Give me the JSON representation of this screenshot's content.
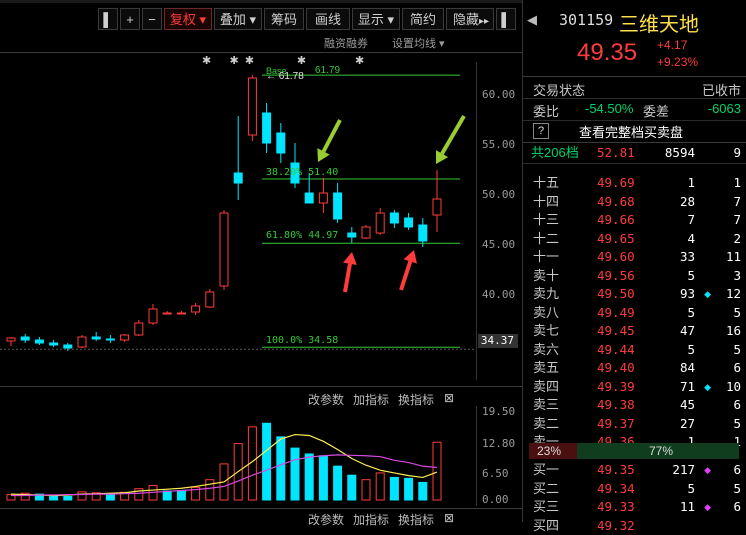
{
  "toolbar": {
    "items": [
      "复权 ▾",
      "叠加 ▾",
      "筹码",
      "画线",
      "显示 ▾",
      "简约",
      "隐藏"
    ],
    "plus": "+",
    "left_glyph": "▌",
    "nav_glyph": "▸▸",
    "sub_links": [
      "融资融券",
      "设置均线 ▾"
    ]
  },
  "chart": {
    "stars": "✱      ✱  ✱              ✱                ✱",
    "y_ticks": [
      "60.00",
      "55.00",
      "50.00",
      "45.00",
      "40.00"
    ],
    "current_price_tag": "34.37",
    "base_label": "Base",
    "hi_label": "← 61.78",
    "hi_label2": "61.79",
    "fib_382": "38.20% 51.40",
    "fib_618": "61.80% 44.97",
    "fib_100": "100.0% 34.58",
    "colors": {
      "up": "#ff3b3b",
      "down": "#00e5ff",
      "fib": "#35c935",
      "arrow_green": "#9acd32",
      "arrow_red": "#ff3b3b",
      "ma_yellow": "#ffee55",
      "ma_purple": "#d64ae0"
    }
  },
  "volume": {
    "links": [
      "改参数",
      "加指标",
      "换指标"
    ],
    "close": "⊠",
    "y_ticks": [
      "19.50",
      "12.80",
      "6.50",
      "0.00"
    ]
  },
  "chart_data": {
    "type": "candlestick",
    "ylim": [
      32,
      63
    ],
    "candles": [
      [
        35.2,
        35.6,
        34.7,
        35.5
      ],
      [
        35.6,
        35.9,
        35.0,
        35.3
      ],
      [
        35.3,
        35.6,
        34.8,
        35.0
      ],
      [
        35.0,
        35.3,
        34.6,
        34.8
      ],
      [
        34.8,
        35.0,
        34.2,
        34.5
      ],
      [
        34.6,
        35.8,
        34.5,
        35.6
      ],
      [
        35.6,
        36.1,
        35.2,
        35.4
      ],
      [
        35.4,
        35.8,
        35.0,
        35.3
      ],
      [
        35.3,
        35.9,
        35.1,
        35.8
      ],
      [
        35.8,
        37.3,
        35.7,
        37.0
      ],
      [
        37.0,
        38.9,
        36.8,
        38.4
      ],
      [
        38.0,
        38.2,
        37.9,
        38.0
      ],
      [
        38.0,
        38.2,
        37.9,
        38.0
      ],
      [
        38.1,
        39.0,
        37.8,
        38.7
      ],
      [
        38.6,
        40.4,
        38.5,
        40.1
      ],
      [
        40.7,
        48.3,
        40.3,
        48.0
      ],
      [
        52.0,
        57.7,
        49.3,
        51.0
      ],
      [
        55.8,
        61.8,
        55.2,
        61.5
      ],
      [
        58.0,
        59.0,
        54.0,
        55.0
      ],
      [
        56.0,
        57.0,
        53.0,
        54.0
      ],
      [
        53.0,
        55.0,
        50.5,
        51.0
      ],
      [
        50.0,
        52.0,
        49.0,
        49.0
      ],
      [
        49.0,
        51.5,
        48.0,
        50.0
      ],
      [
        50.0,
        51.0,
        47.0,
        47.4
      ],
      [
        46.0,
        46.6,
        45.0,
        45.6
      ],
      [
        45.5,
        46.8,
        45.4,
        46.6
      ],
      [
        46.0,
        48.5,
        45.8,
        48.0
      ],
      [
        48.0,
        48.3,
        46.5,
        47.0
      ],
      [
        47.5,
        48.0,
        46.3,
        46.6
      ],
      [
        46.8,
        47.5,
        44.6,
        45.2
      ],
      [
        47.8,
        52.3,
        46.1,
        49.4
      ]
    ],
    "volumes": [
      1.2,
      1.5,
      1.3,
      1.0,
      0.8,
      1.8,
      1.6,
      1.4,
      1.7,
      2.5,
      3.2,
      2.0,
      2.1,
      2.8,
      4.5,
      8.0,
      12.5,
      16.2,
      17.0,
      14.0,
      11.5,
      10.2,
      9.8,
      7.5,
      5.5,
      4.5,
      6.0,
      5.0,
      4.8,
      3.9,
      12.8
    ],
    "volume_up": [
      true,
      true,
      false,
      false,
      false,
      true,
      true,
      false,
      true,
      true,
      true,
      false,
      false,
      true,
      true,
      true,
      true,
      true,
      false,
      false,
      false,
      false,
      false,
      false,
      false,
      true,
      true,
      false,
      false,
      false,
      true
    ],
    "ma5": [
      1.3,
      1.2,
      1.1,
      1.0,
      1.1,
      1.3,
      1.4,
      1.5,
      1.6,
      2.0,
      2.2,
      2.4,
      2.6,
      3.0,
      3.5,
      4.0,
      6.3,
      8.5,
      11.0,
      13.5,
      14.5,
      14.3,
      13.0,
      11.2,
      9.2,
      7.7,
      6.6,
      6.0,
      5.4,
      5.0,
      6.2
    ],
    "ma10": [
      1.0,
      1.0,
      1.1,
      1.1,
      1.2,
      1.2,
      1.3,
      1.3,
      1.4,
      1.5,
      1.7,
      1.9,
      2.1,
      2.3,
      2.6,
      3.0,
      4.2,
      5.5,
      6.6,
      7.8,
      8.9,
      9.5,
      9.8,
      10.0,
      9.9,
      9.8,
      9.6,
      8.8,
      8.3,
      7.5,
      7.2
    ]
  },
  "panel": {
    "code": "301159",
    "name": "三维天地",
    "price": "49.35",
    "change": "+4.17",
    "change_pct": "+9.23%",
    "trade_state_label": "交易状态",
    "trade_state": "已收市",
    "weibi_label": "委比",
    "weibi": "-54.50%",
    "weicha_label": "委差",
    "weicha": "-6063",
    "full_book_q": "?",
    "full_book": "查看完整档买卖盘",
    "total_label": "共206档",
    "total_price": "52.81",
    "total_vol": "8594",
    "total_cnt": "9",
    "sell_levels": [
      {
        "label": "十五",
        "price": "49.69",
        "vol": "1",
        "mark": "",
        "cnt": "1"
      },
      {
        "label": "十四",
        "price": "49.68",
        "vol": "28",
        "mark": "",
        "cnt": "7"
      },
      {
        "label": "十三",
        "price": "49.66",
        "vol": "7",
        "mark": "",
        "cnt": "7"
      },
      {
        "label": "十二",
        "price": "49.65",
        "vol": "4",
        "mark": "",
        "cnt": "2"
      },
      {
        "label": "十一",
        "price": "49.60",
        "vol": "33",
        "mark": "",
        "cnt": "11"
      },
      {
        "label": "卖十",
        "price": "49.56",
        "vol": "5",
        "mark": "",
        "cnt": "3"
      },
      {
        "label": "卖九",
        "price": "49.50",
        "vol": "93",
        "mark": "◆",
        "cnt": "12"
      },
      {
        "label": "卖八",
        "price": "49.49",
        "vol": "5",
        "mark": "",
        "cnt": "5"
      },
      {
        "label": "卖七",
        "price": "49.45",
        "vol": "47",
        "mark": "",
        "cnt": "16"
      },
      {
        "label": "卖六",
        "price": "49.44",
        "vol": "5",
        "mark": "",
        "cnt": "5"
      },
      {
        "label": "卖五",
        "price": "49.40",
        "vol": "84",
        "mark": "",
        "cnt": "6"
      },
      {
        "label": "卖四",
        "price": "49.39",
        "vol": "71",
        "mark": "◆",
        "cnt": "10"
      },
      {
        "label": "卖三",
        "price": "49.38",
        "vol": "45",
        "mark": "",
        "cnt": "6"
      },
      {
        "label": "卖二",
        "price": "49.37",
        "vol": "27",
        "mark": "",
        "cnt": "5"
      },
      {
        "label": "卖一",
        "price": "49.36",
        "vol": "1",
        "mark": "",
        "cnt": "1"
      }
    ],
    "ratio_sell": "23%",
    "ratio_buy": "77%",
    "buy_levels": [
      {
        "label": "买一",
        "price": "49.35",
        "vol": "217",
        "mark": "◆",
        "cnt": "6"
      },
      {
        "label": "买二",
        "price": "49.34",
        "vol": "5",
        "mark": "",
        "cnt": "5"
      },
      {
        "label": "买三",
        "price": "49.33",
        "vol": "11",
        "mark": "◆",
        "cnt": "6"
      },
      {
        "label": "买四",
        "price": "49.32",
        "vol": "",
        "mark": "",
        "cnt": ""
      }
    ]
  }
}
